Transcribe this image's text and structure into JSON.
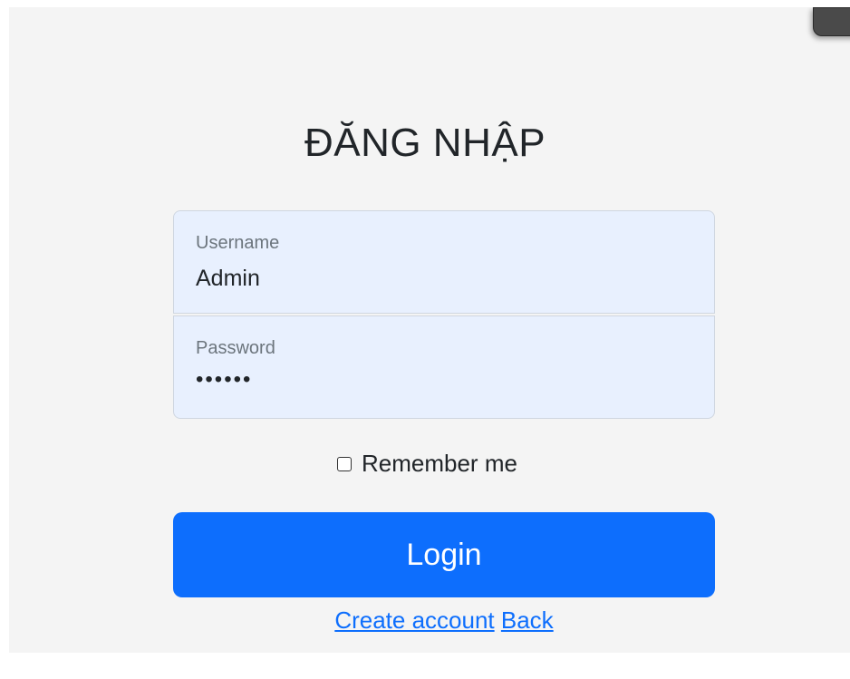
{
  "form": {
    "title": "ĐĂNG NHẬP",
    "username": {
      "label": "Username",
      "value": "Admin"
    },
    "password": {
      "label": "Password",
      "value": "••••••"
    },
    "remember_label": "Remember me",
    "remember_checked": false,
    "login_label": "Login",
    "create_account_label": "Create account",
    "back_label": "Back"
  },
  "colors": {
    "background": "#f4f4f4",
    "input_background": "#e8f0fe",
    "primary": "#0d6efd",
    "link": "#0d6efd"
  }
}
